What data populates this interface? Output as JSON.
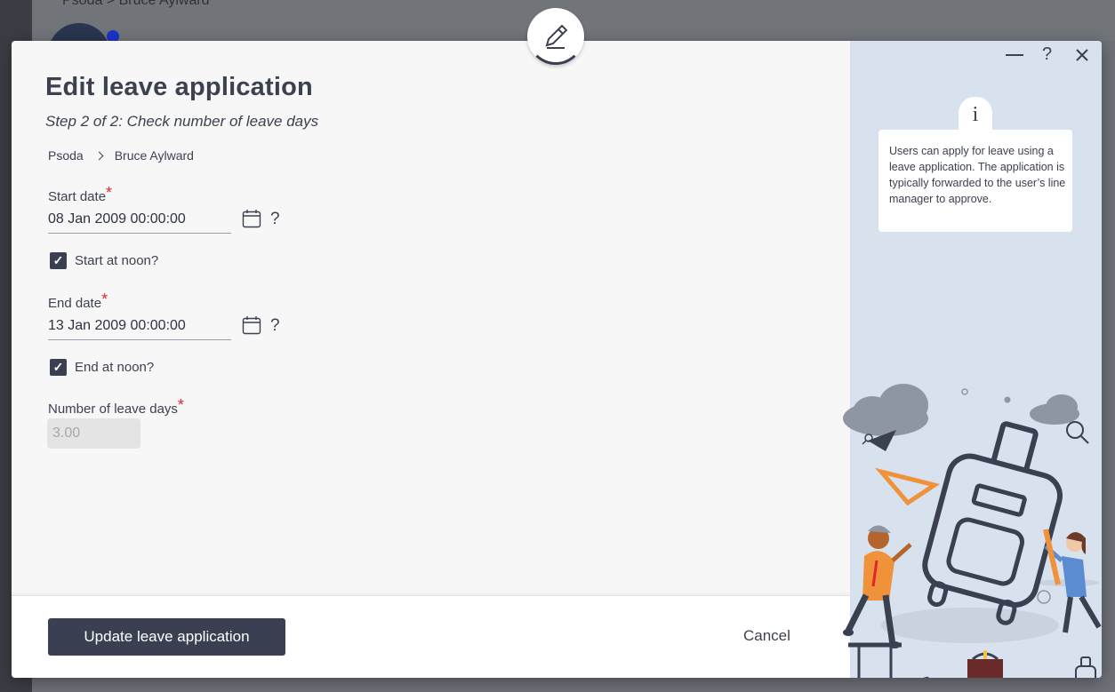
{
  "background": {
    "crumb_text": "Psoda   >   Bruce Aylward"
  },
  "modal": {
    "title": "Edit leave application",
    "subtitle": "Step 2 of 2: Check number of leave days",
    "breadcrumb": [
      "Psoda",
      "Bruce Aylward"
    ],
    "start_date": {
      "label": "Start date",
      "required_mark": "*",
      "value": "08 Jan 2009 00:00:00",
      "help": "?"
    },
    "start_noon": {
      "label": "Start at noon?",
      "checked": true
    },
    "end_date": {
      "label": "End date",
      "required_mark": "*",
      "value": "13 Jan 2009 00:00:00",
      "help": "?"
    },
    "end_noon": {
      "label": "End at noon?",
      "checked": true
    },
    "leave_days": {
      "label": "Number of leave days",
      "required_mark": "*",
      "value": "3.00"
    },
    "footer": {
      "primary_button": "Update leave application",
      "cancel": "Cancel"
    }
  },
  "side_panel": {
    "window_controls": [
      "minimize-icon",
      "help-icon",
      "close-icon"
    ],
    "help_symbol": "?",
    "info_icon_glyph": "i",
    "info_text": "Users can apply for leave using a leave application. The application is typically forwarded to the user’s line manager to approve."
  },
  "colors": {
    "primary": "#3a4052",
    "side_panel_bg": "#d8e1ee",
    "required": "#e0262b",
    "accent_orange": "#f0923a"
  }
}
